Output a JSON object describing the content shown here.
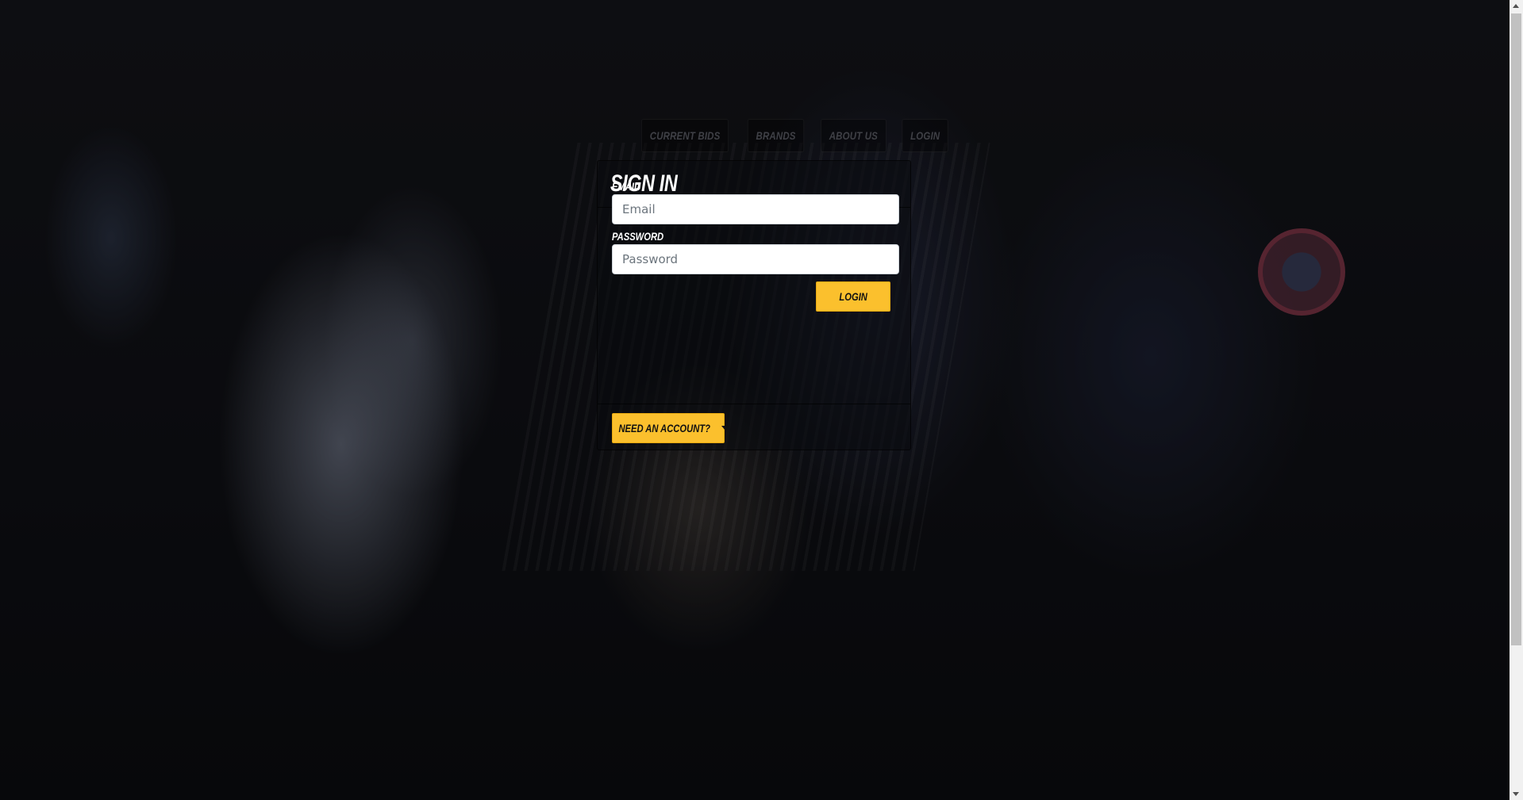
{
  "nav": {
    "items": [
      {
        "label": "Current Bids"
      },
      {
        "label": "Brands"
      },
      {
        "label": "About Us"
      },
      {
        "label": "Login"
      }
    ]
  },
  "card": {
    "title": "Sign In",
    "email": {
      "label": "Email",
      "placeholder": "Email",
      "value": ""
    },
    "password": {
      "label": "Password",
      "placeholder": "Password",
      "value": ""
    },
    "login_label": "Login",
    "account_label": "Need an account?"
  },
  "icons": {
    "account_dropdown": "caret-down-icon"
  },
  "colors": {
    "accent": "#fbc02d",
    "title_text": "#ffffff",
    "nav_text": "#3f4046"
  }
}
